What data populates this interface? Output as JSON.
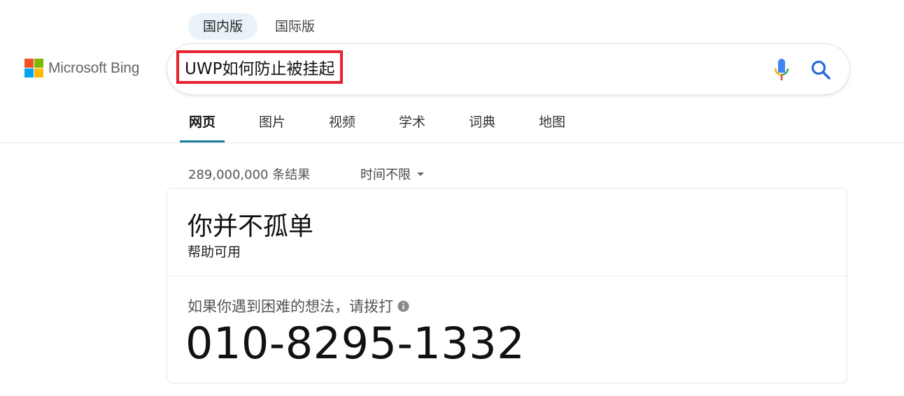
{
  "region_tabs": [
    {
      "label": "国内版",
      "active": true
    },
    {
      "label": "国际版",
      "active": false
    }
  ],
  "logo": {
    "text": "Microsoft Bing",
    "colors": [
      "#f25022",
      "#7fba00",
      "#00a4ef",
      "#ffb900"
    ]
  },
  "search": {
    "query": "UWP如何防止被挂起",
    "mic_icon": "microphone-icon",
    "search_icon": "search-icon"
  },
  "nav_tabs": [
    {
      "label": "网页",
      "active": true
    },
    {
      "label": "图片"
    },
    {
      "label": "视频"
    },
    {
      "label": "学术"
    },
    {
      "label": "词典"
    },
    {
      "label": "地图"
    }
  ],
  "results": {
    "count": "289,000,000 条结果",
    "time_filter": "时间不限"
  },
  "card": {
    "title": "你并不孤单",
    "subtitle": "帮助可用",
    "prompt": "如果你遇到困难的想法，请拨打",
    "phone": "010-8295-1332"
  },
  "colors": {
    "accent": "#1a7ea1",
    "highlight_border": "#e8232f",
    "search_blue": "#2b6cd9"
  }
}
